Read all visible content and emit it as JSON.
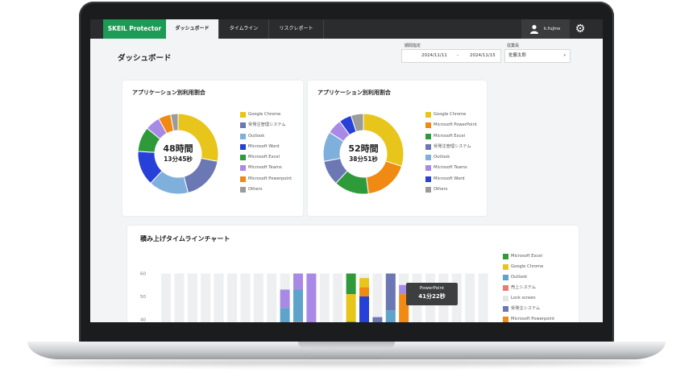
{
  "header": {
    "brand": "SKEIL Protector",
    "tabs": [
      {
        "label": "ダッシュボード",
        "active": true
      },
      {
        "label": "タイムライン",
        "active": false
      },
      {
        "label": "リスクレポート",
        "active": false
      }
    ],
    "user_name": "k.fujino",
    "gear_icon": "gear-icon"
  },
  "page": {
    "title": "ダッシュボード",
    "period_label": "期間指定",
    "date_from": "2024/11/11",
    "date_sep": "-",
    "date_to": "2024/11/15",
    "employee_label": "従業員",
    "employee_value": "佐藤太郎"
  },
  "charts": [
    {
      "title": "アプリケーション別利用割合",
      "center_main": "48時間",
      "center_sub": "13分45秒",
      "chart_data": {
        "type": "pie",
        "categories": [
          "Google Chrome",
          "受発注管理システム",
          "Outlook",
          "Microsoft Word",
          "Microsoft Excel",
          "Microsoft Teams",
          "Microsoft Powerpoint",
          "Others"
        ],
        "values": [
          28,
          18,
          16,
          14,
          10,
          6,
          5,
          3
        ],
        "colors": [
          "#e8c51b",
          "#6b78b4",
          "#7fb0dc",
          "#2740d8",
          "#2f9a3a",
          "#a88ae6",
          "#f18a12",
          "#9b9b9b"
        ]
      }
    },
    {
      "title": "アプリケーション別利用割合",
      "center_main": "52時間",
      "center_sub": "38分51秒",
      "chart_data": {
        "type": "pie",
        "categories": [
          "Google Chrome",
          "Microsoft PowerPoint",
          "Microsoft Excel",
          "受発注管理システム",
          "Outlook",
          "Microsoft Teams",
          "Microsoft Word",
          "Others"
        ],
        "values": [
          30,
          18,
          14,
          10,
          12,
          6,
          5,
          5
        ],
        "colors": [
          "#e8c51b",
          "#f18a12",
          "#2f9a3a",
          "#6b78b4",
          "#7fb0dc",
          "#a88ae6",
          "#2740d8",
          "#9b9b9b"
        ]
      }
    }
  ],
  "timeline": {
    "title": "積み上げタイムラインチャート",
    "legend": [
      {
        "label": "Microsoft Excel",
        "color": "#2f9a3a"
      },
      {
        "label": "Google Chrome",
        "color": "#e8c51b"
      },
      {
        "label": "Outlook",
        "color": "#5ea3c9"
      },
      {
        "label": "売上システム",
        "color": "#e87b73"
      },
      {
        "label": "Lock screen",
        "color": "#e4e5e7"
      },
      {
        "label": "受発注システム",
        "color": "#6b78b4"
      },
      {
        "label": "Microsoft Powerpoint",
        "color": "#f18a12"
      }
    ],
    "tooltip": {
      "app": "PowerPoint",
      "duration": "41分22秒"
    },
    "chart_data": {
      "type": "bar",
      "stacked": true,
      "ylim": [
        30,
        60
      ],
      "yticks": [
        "60",
        "50",
        "40",
        "30"
      ],
      "bars": [
        [],
        [],
        [],
        [],
        [],
        [],
        [],
        [],
        [],
        [
          [
            "#2f9a3a",
            3
          ],
          [
            "#5ea3c9",
            12
          ],
          [
            "#a88ae6",
            8
          ]
        ],
        [
          [
            "#e8c51b",
            3
          ],
          [
            "#e87b73",
            9
          ],
          [
            "#5ea3c9",
            14
          ],
          [
            "#a88ae6",
            7
          ]
        ],
        [
          [
            "#2f9a3a",
            3
          ],
          [
            "#a88ae6",
            30
          ]
        ],
        [],
        [],
        [
          [
            "#2f9a3a",
            12
          ],
          [
            "#e8c51b",
            12
          ],
          [
            "#2f9a3a",
            9
          ]
        ],
        [
          [
            "#2740d8",
            20
          ],
          [
            "#f18a12",
            4
          ],
          [
            "#e8c51b",
            4
          ]
        ],
        [
          [
            "#2f9a3a",
            6
          ],
          [
            "#6b78b4",
            5
          ]
        ],
        [
          [
            "#2f9a3a",
            6
          ],
          [
            "#5ea3c9",
            8
          ],
          [
            "#6b78b4",
            16
          ]
        ],
        [
          [
            "#f18a12",
            21
          ],
          [
            "#a88ae6",
            4
          ]
        ],
        [],
        [],
        [],
        [],
        [],
        []
      ]
    }
  }
}
